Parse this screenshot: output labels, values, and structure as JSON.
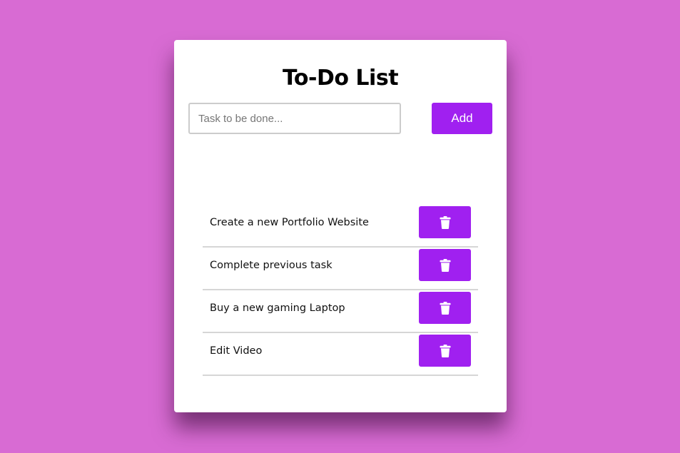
{
  "app": {
    "title": "To-Do List"
  },
  "form": {
    "input_value": "",
    "input_placeholder": "Task to be done...",
    "add_label": "Add"
  },
  "tasks": [
    {
      "text": "Create a new Portfolio Website",
      "delete_icon": "trash-icon"
    },
    {
      "text": "Complete previous task",
      "delete_icon": "trash-icon"
    },
    {
      "text": "Buy a new gaming Laptop",
      "delete_icon": "trash-icon"
    },
    {
      "text": "Edit Video",
      "delete_icon": "trash-icon"
    }
  ],
  "colors": {
    "background": "#d86bd3",
    "card": "#ffffff",
    "accent": "#a020f0",
    "divider": "#d6d6d6",
    "input_border": "#cccccc"
  }
}
